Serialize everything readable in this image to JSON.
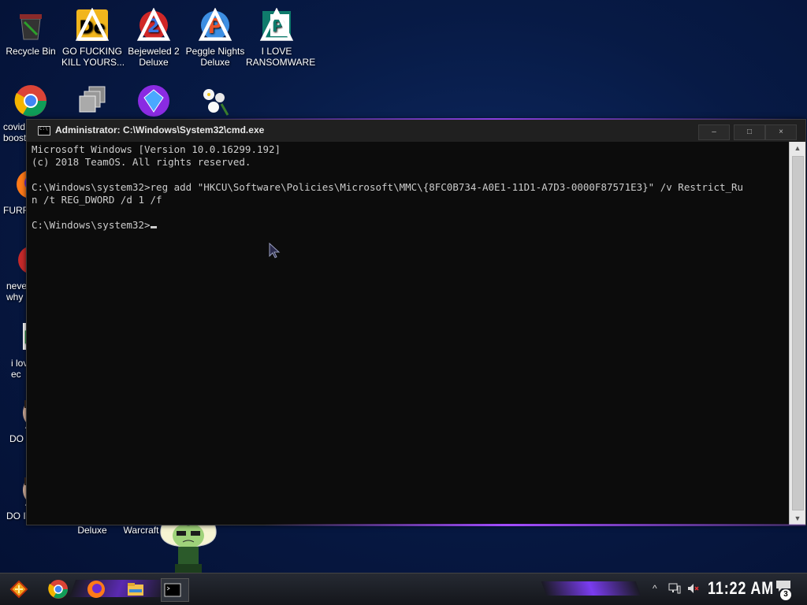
{
  "desktop": {
    "icons": [
      {
        "id": "recycle-bin",
        "label": "Recycle Bin"
      },
      {
        "id": "go-fucking",
        "label": "GO FUCKING\nKILL YOURS..."
      },
      {
        "id": "bejeweled",
        "label": "Bejeweled 2\nDeluxe"
      },
      {
        "id": "peggle",
        "label": "Peggle Nights\nDeluxe"
      },
      {
        "id": "i-love-ransomware",
        "label": "I LOVE\nRANSOMWARE"
      },
      {
        "id": "covid",
        "label": "covid\nbooste"
      },
      {
        "id": "furr",
        "label": "FURR"
      },
      {
        "id": "never",
        "label": "neve\nwhy"
      },
      {
        "id": "i-love-ec",
        "label": "i lov\nec"
      },
      {
        "id": "do-1",
        "label": "DO I"
      },
      {
        "id": "do-2",
        "label": "DO IT"
      },
      {
        "id": "deluxe",
        "label": "Deluxe"
      },
      {
        "id": "warcraft",
        "label": "Warcraft"
      }
    ]
  },
  "window": {
    "title": "Administrator: C:\\Windows\\System32\\cmd.exe",
    "minimize_label": "–",
    "maximize_label": "□",
    "close_label": "×",
    "console_lines": [
      "Microsoft Windows [Version 10.0.16299.192]",
      "(c) 2018 TeamOS. All rights reserved.",
      "",
      "C:\\Windows\\system32>reg add \"HKCU\\Software\\Policies\\Microsoft\\MMC\\{8FC0B734-A0E1-11D1-A7D3-0000F87571E3}\" /v Restrict_Ru",
      "n /t REG_DWORD /d 1 /f",
      "",
      "C:\\Windows\\system32>"
    ],
    "scroll_up": "▲",
    "scroll_down": "▼"
  },
  "taskbar": {
    "clock": "11:22 AM",
    "notification_count": "3",
    "tray_chevron": "^"
  },
  "colors": {
    "accent": "#8a3fe0",
    "console_bg": "#0c0c0c",
    "console_text": "#cccccc"
  }
}
